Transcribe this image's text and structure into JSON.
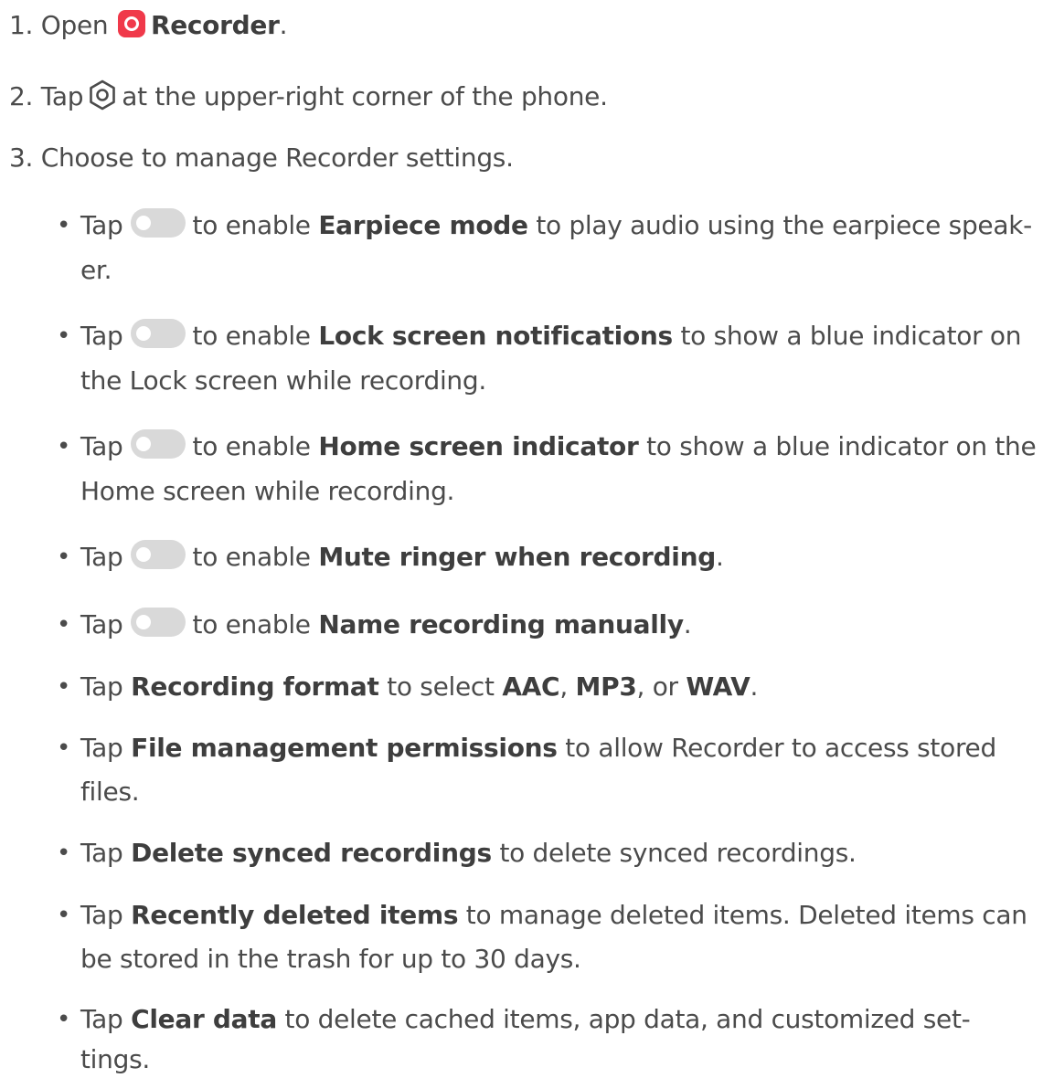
{
  "steps": {
    "s1": {
      "num": "1.",
      "pre": "Open",
      "bold": "Recorder",
      "post": "."
    },
    "s2": {
      "num": "2.",
      "pre": "Tap",
      "post": "at the upper-right corner of the phone."
    },
    "s3": {
      "num": "3.",
      "text": "Choose to manage Recorder settings."
    }
  },
  "bullets": {
    "b1": {
      "tap": "Tap",
      "mid": "to enable",
      "bold": "Earpiece mode",
      "post": "to play audio using the earpiece speak-",
      "cont": "er."
    },
    "b2": {
      "tap": "Tap",
      "mid": "to enable",
      "bold": "Lock screen notifications",
      "post": "to show a blue indicator on",
      "cont": "the Lock screen while recording."
    },
    "b3": {
      "tap": "Tap",
      "mid": "to enable",
      "bold": "Home screen indicator",
      "post": "to show a blue indicator on the",
      "cont": "Home screen while recording."
    },
    "b4": {
      "tap": "Tap",
      "mid": "to enable",
      "bold": "Mute ringer when recording",
      "post": "."
    },
    "b5": {
      "tap": "Tap",
      "mid": "to enable",
      "bold": "Name recording manually",
      "post": "."
    },
    "b6": {
      "tap": "Tap",
      "bold": "Recording format",
      "mid": "to select",
      "opt1": "AAC",
      "sep1": ",",
      "opt2": "MP3",
      "sep2": ", or",
      "opt3": "WAV",
      "post": "."
    },
    "b7": {
      "tap": "Tap",
      "bold": "File management permissions",
      "post": "to allow Recorder to access stored",
      "cont": "files."
    },
    "b8": {
      "tap": "Tap",
      "bold": "Delete synced recordings",
      "post": "to delete synced recordings."
    },
    "b9": {
      "tap": "Tap",
      "bold": "Recently deleted items",
      "post": "to manage deleted items. Deleted items can",
      "cont": "be stored in the trash for up to 30 days."
    },
    "b10": {
      "tap": "Tap",
      "bold": "Clear data",
      "post": "to delete cached items, app data, and customized set-",
      "cont": "tings."
    }
  },
  "bullet_char": "•",
  "icons": {
    "recorder": "recorder-app-icon",
    "settings": "settings-gear-icon",
    "toggle": "toggle-switch-off-icon"
  },
  "colors": {
    "text": "#4b4b4b",
    "recorder_icon": "#f0394a",
    "toggle_off": "#d9d9d9"
  }
}
